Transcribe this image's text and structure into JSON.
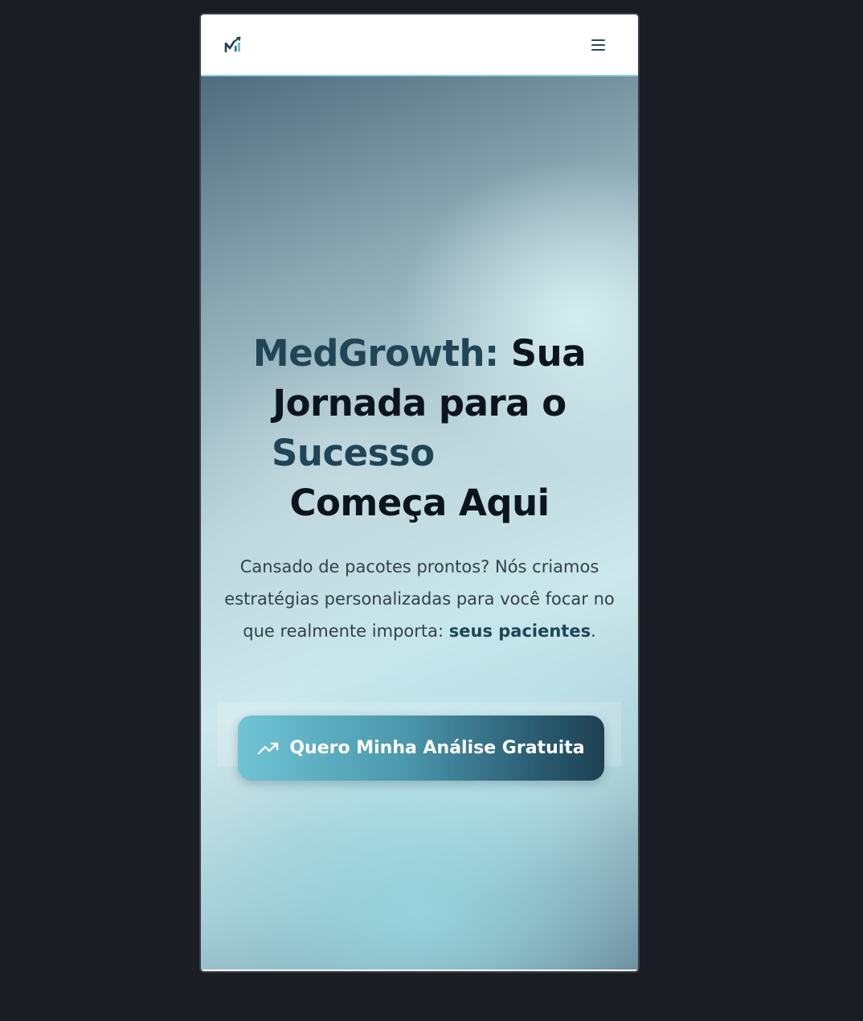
{
  "navbar": {
    "logo_icon": "medgrowth-chart-logo-icon",
    "menu_icon": "hamburger-menu-icon"
  },
  "hero": {
    "headline": {
      "part1_accent": "MedGrowth:",
      "part1_rest": " Sua",
      "line2": "Jornada para o",
      "line3_accent": "Sucesso",
      "line4": "Começa Aqui"
    },
    "subtext": {
      "before": "Cansado de pacotes prontos? Nós criamos estratégias personalizadas para você focar no que realmente importa: ",
      "emphasis": "seus pacientes",
      "after": "."
    },
    "cta": {
      "icon": "trending-up-icon",
      "label": "Quero Minha Análise Gratuita"
    }
  },
  "colors": {
    "accent": "#1f4557",
    "headline": "#0c1420",
    "page_background": "#1a1d24",
    "cta_gradient_start": "#6fc4d4",
    "cta_gradient_end": "#1d4152"
  }
}
